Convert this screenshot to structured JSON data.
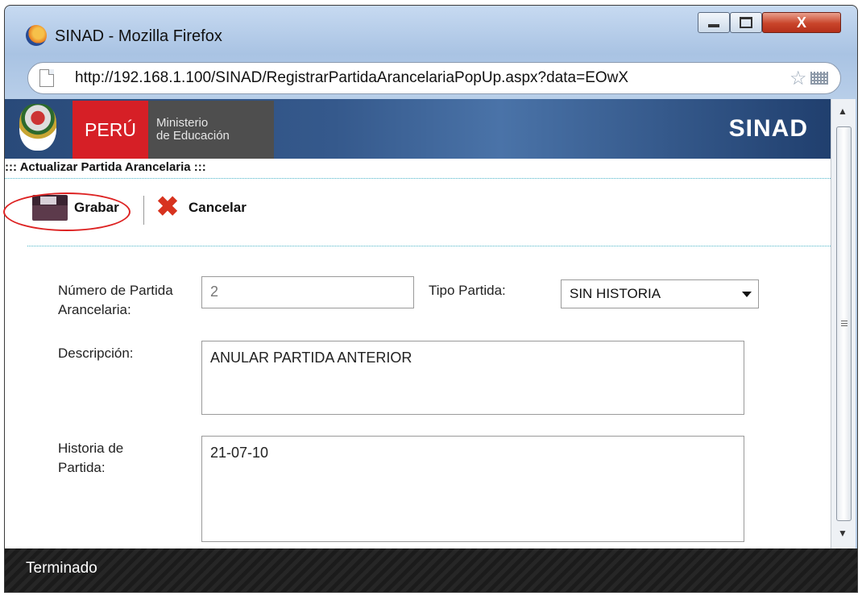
{
  "window": {
    "title": "SINAD - Mozilla Firefox",
    "controls": {
      "minimize": "minimize",
      "maximize": "maximize",
      "close": "X"
    }
  },
  "urlbar": {
    "url": "http://192.168.1.100/SINAD/RegistrarPartidaArancelariaPopUp.aspx?data=EOwX"
  },
  "header": {
    "country": "PERÚ",
    "ministry_line1": "Ministerio",
    "ministry_line2": "de Educación",
    "brand": "SINAD"
  },
  "page": {
    "heading": "::: Actualizar Partida Arancelaria :::"
  },
  "toolbar": {
    "save_label": "Grabar",
    "cancel_label": "Cancelar"
  },
  "form": {
    "numero_label": "Número de Partida Arancelaria:",
    "numero_value": "2",
    "tipo_label": "Tipo Partida:",
    "tipo_selected": "SIN HISTORIA",
    "descripcion_label": "Descripción:",
    "descripcion_value": "ANULAR PARTIDA ANTERIOR",
    "historia_label": "Historia de Partida:",
    "historia_value": "21-07-10"
  },
  "status": {
    "text": "Terminado"
  },
  "colors": {
    "peru_red": "#d61f26",
    "header_blue": "#294a79",
    "highlight_ring": "#dd2222"
  }
}
